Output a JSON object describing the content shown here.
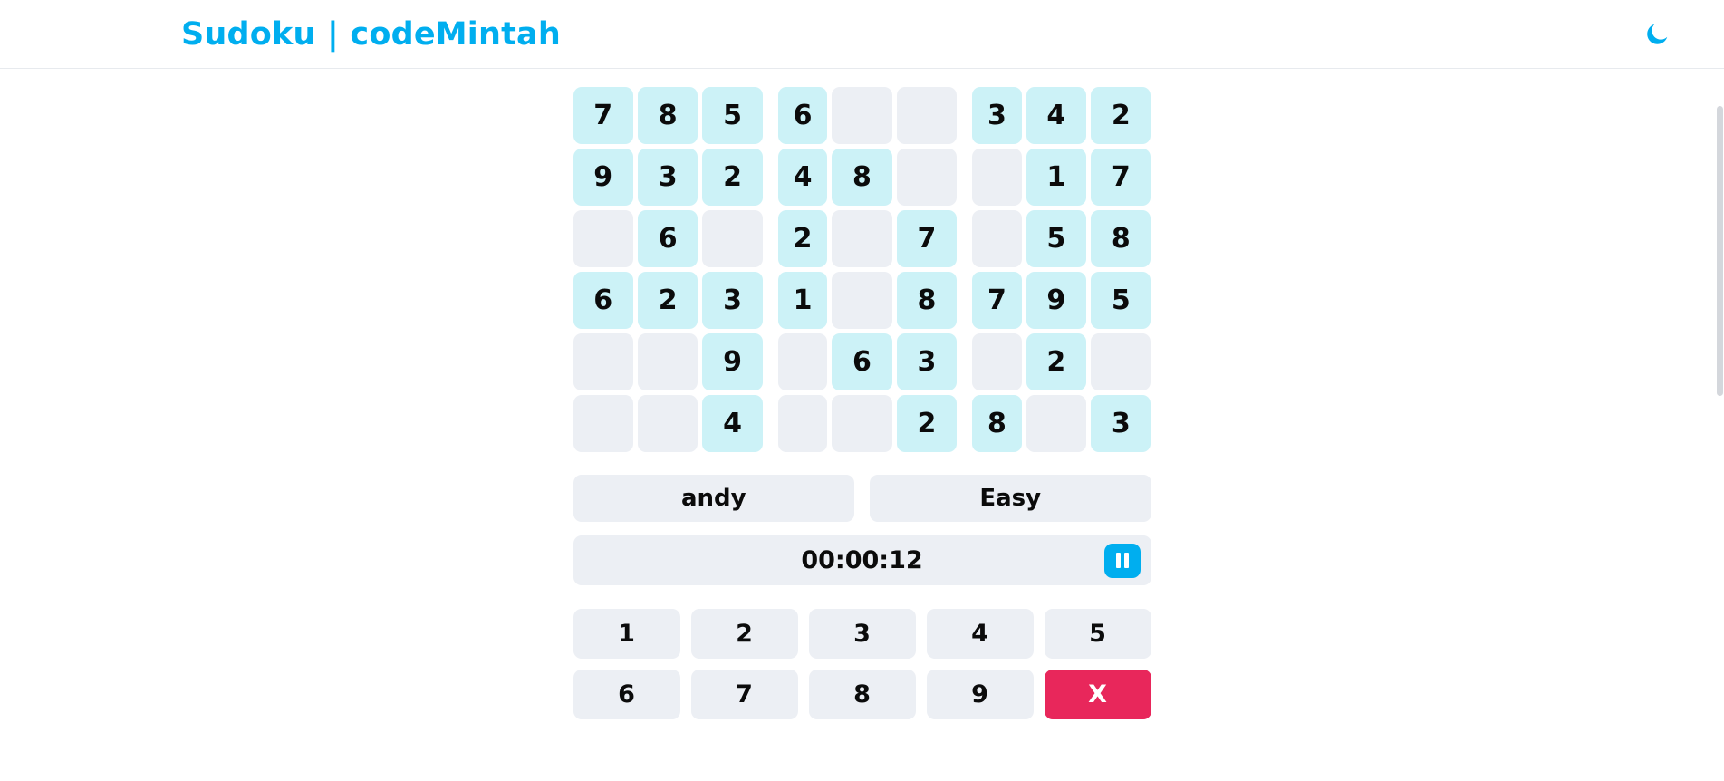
{
  "header": {
    "title": "Sudoku | codeMintah",
    "brand_color": "#00AEEF",
    "theme_toggle_icon": "moon-icon"
  },
  "board": {
    "visible_rows": 6,
    "columns": 9,
    "filled_cell_color": "#ccf2f7",
    "empty_cell_color": "#eceff4",
    "rows": [
      [
        "7",
        "8",
        "5",
        "6",
        "",
        "",
        "3",
        "4",
        "2"
      ],
      [
        "9",
        "3",
        "2",
        "4",
        "8",
        "",
        "",
        "1",
        "7"
      ],
      [
        "",
        "6",
        "",
        "2",
        "",
        "7",
        "",
        "5",
        "8"
      ],
      [
        "6",
        "2",
        "3",
        "1",
        "",
        "8",
        "7",
        "9",
        "5"
      ],
      [
        "",
        "",
        "9",
        "",
        "6",
        "3",
        "",
        "2",
        ""
      ],
      [
        "",
        "",
        "4",
        "",
        "",
        "2",
        "8",
        "",
        "3"
      ]
    ]
  },
  "meta": {
    "player_name": "andy",
    "difficulty": "Easy"
  },
  "timer": {
    "elapsed": "00:00:12",
    "pause_icon": "pause-icon"
  },
  "numpad": {
    "keys": [
      "1",
      "2",
      "3",
      "4",
      "5",
      "6",
      "7",
      "8",
      "9"
    ],
    "erase_label": "X",
    "erase_color": "#E8275B"
  }
}
